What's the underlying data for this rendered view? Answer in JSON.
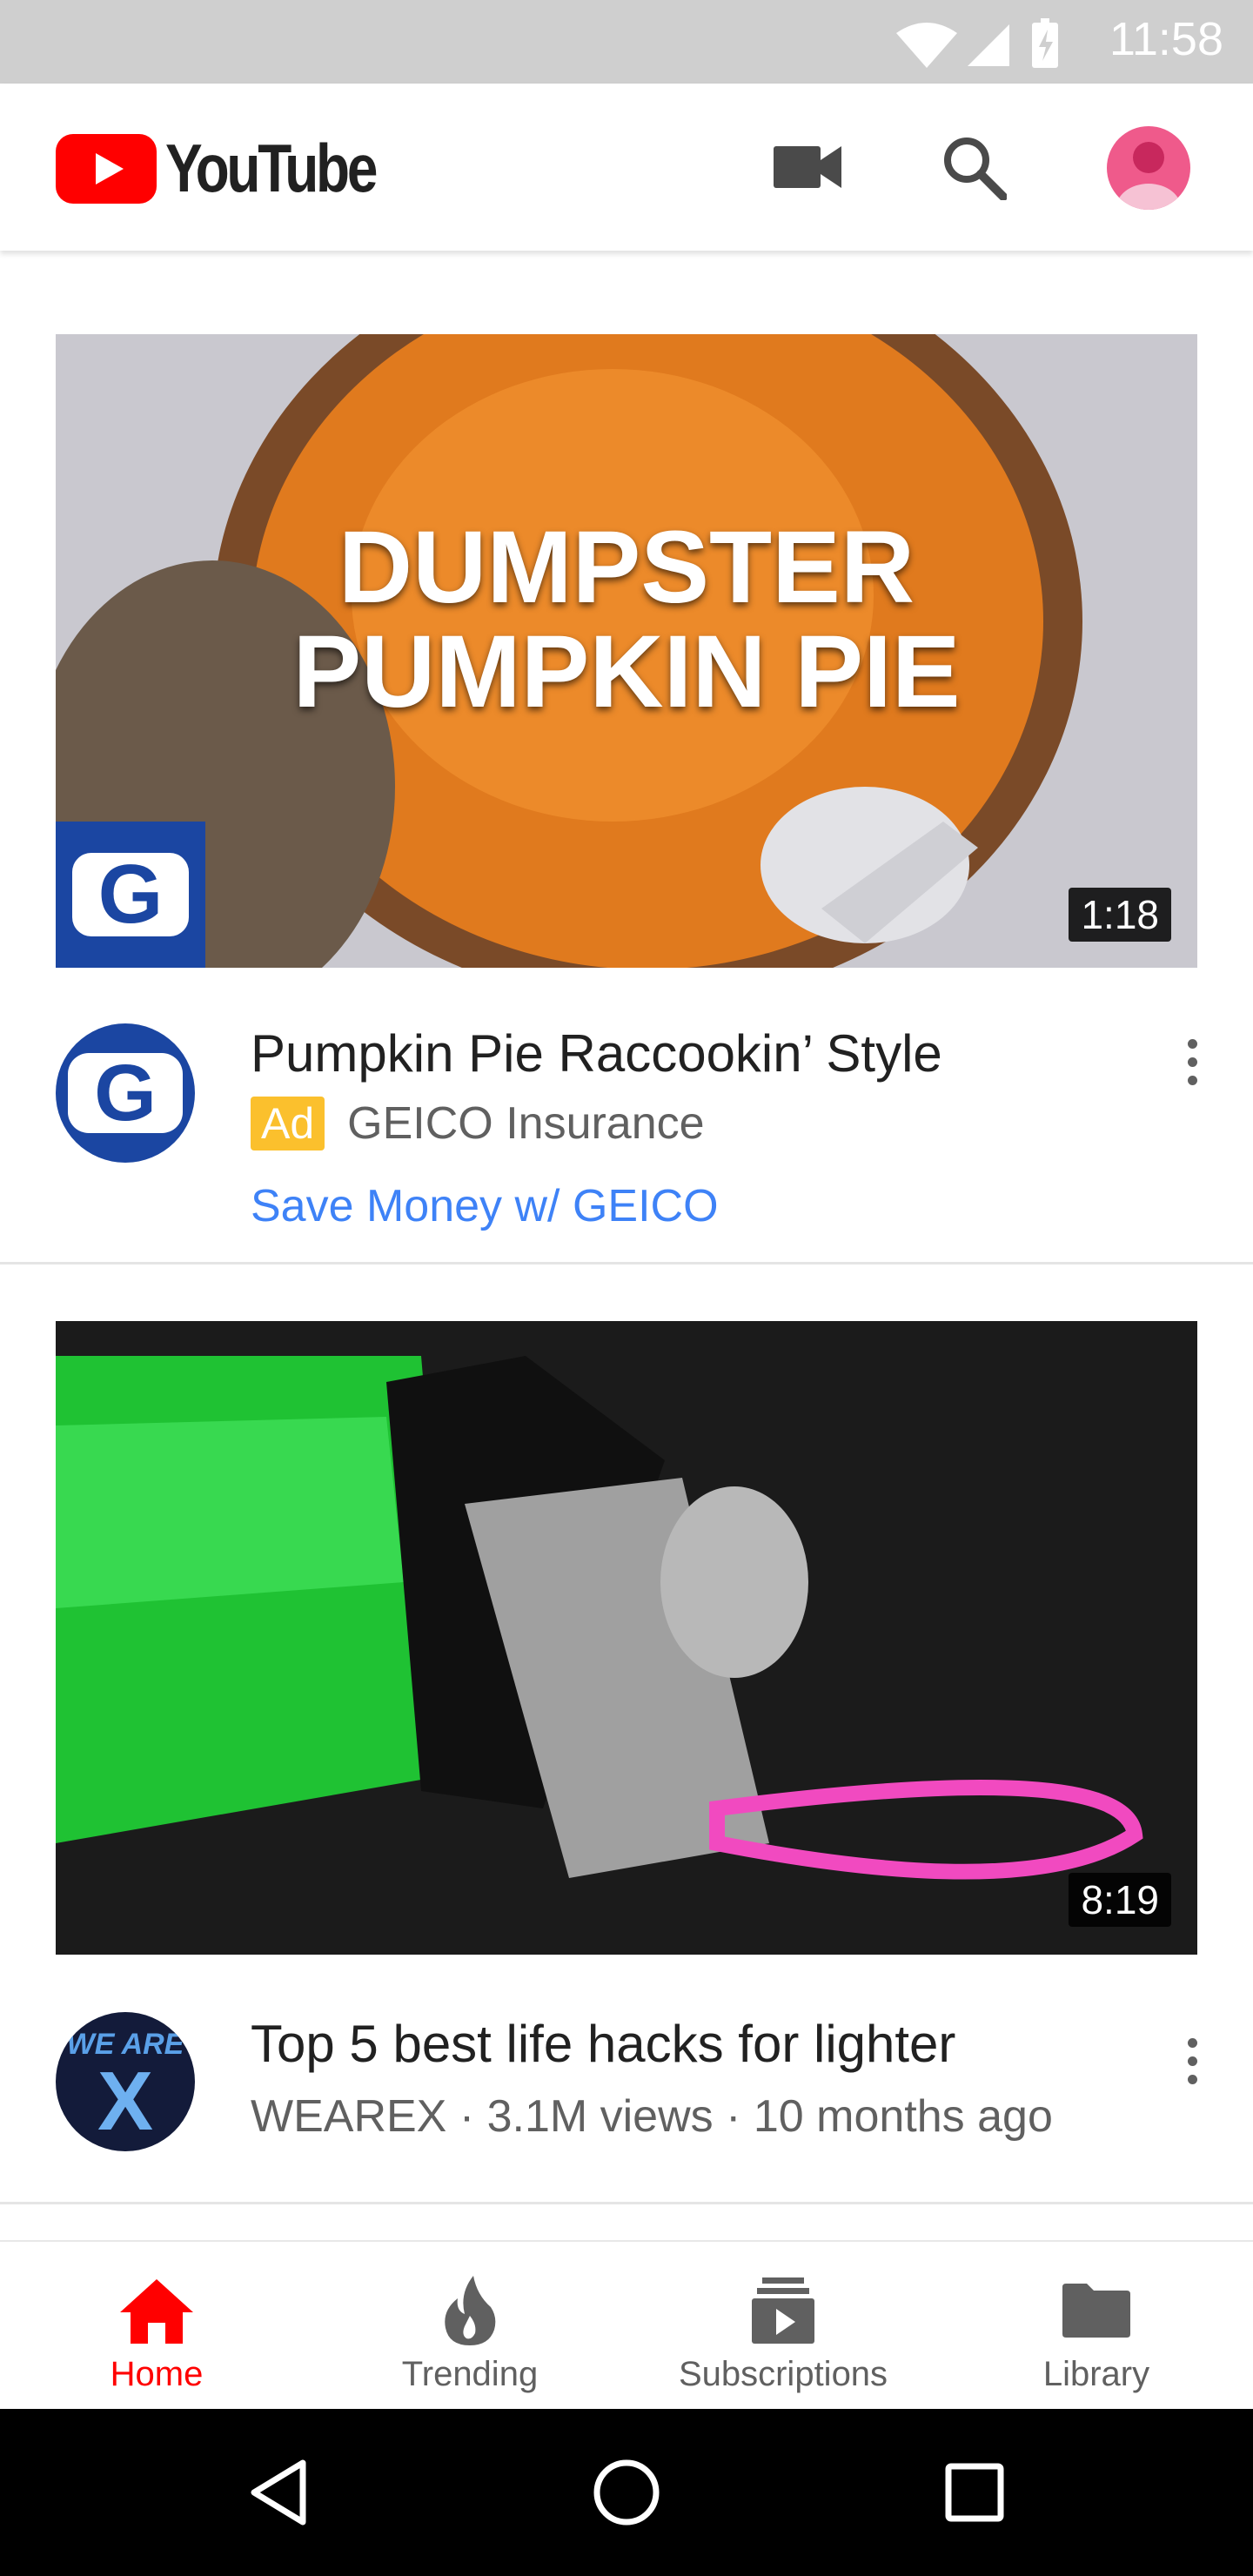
{
  "status_bar": {
    "time": "11:58"
  },
  "app": {
    "name": "YouTube"
  },
  "colors": {
    "brand_red": "#ff0000",
    "link_blue": "#3e82f7",
    "ad_badge": "#fbc02d"
  },
  "feed": [
    {
      "thumbnail_text_line1": "DUMPSTER",
      "thumbnail_text_line2": "PUMPKIN PIE",
      "thumbnail_badge_letter": "G",
      "duration": "1:18",
      "channel_avatar_letter": "G",
      "title": "Pumpkin Pie Raccookin’ Style",
      "ad_label": "Ad",
      "advertiser": "GEICO Insurance",
      "cta": "Save Money w/ GEICO"
    },
    {
      "duration": "8:19",
      "channel_avatar_text": "WE ARE",
      "channel_avatar_letter": "X",
      "title": "Top 5 best life hacks for lighter",
      "meta": "WEAREX · 3.1M views · 10 months ago"
    }
  ],
  "bottom_nav": [
    {
      "label": "Home",
      "icon": "home-icon",
      "active": true
    },
    {
      "label": "Trending",
      "icon": "flame-icon",
      "active": false
    },
    {
      "label": "Subscriptions",
      "icon": "subscriptions-icon",
      "active": false
    },
    {
      "label": "Library",
      "icon": "folder-icon",
      "active": false
    }
  ]
}
